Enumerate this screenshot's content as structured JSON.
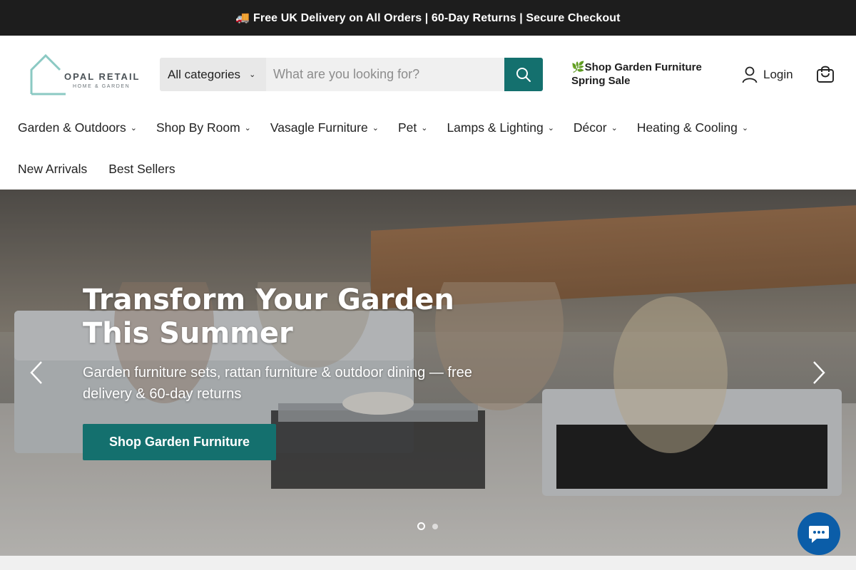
{
  "announcement": {
    "text": "🚚 Free UK Delivery on All Orders | 60-Day Returns | Secure Checkout"
  },
  "logo": {
    "name": "OPAL RETAIL",
    "tagline": "HOME & GARDEN"
  },
  "search": {
    "category_label": "All categories",
    "placeholder": "What are you looking for?",
    "button_icon": "search-icon"
  },
  "promo": {
    "text": "🌿Shop Garden Furniture Spring Sale"
  },
  "account": {
    "login_label": "Login",
    "cart_icon": "cart-icon"
  },
  "nav": {
    "primary": [
      {
        "label": "Garden & Outdoors"
      },
      {
        "label": "Shop By Room"
      },
      {
        "label": "Vasagle Furniture"
      },
      {
        "label": "Pet"
      },
      {
        "label": "Lamps & Lighting"
      },
      {
        "label": "Décor"
      },
      {
        "label": "Heating & Cooling"
      }
    ],
    "secondary": [
      {
        "label": "New Arrivals"
      },
      {
        "label": "Best Sellers"
      }
    ]
  },
  "hero": {
    "title": "Transform Your Garden This Summer",
    "subtitle": "Garden furniture sets, rattan furniture & outdoor dining — free delivery & 60-day returns",
    "cta_label": "Shop Garden Furniture",
    "slides": {
      "count": 2,
      "active": 1
    }
  },
  "colors": {
    "accent": "#14706e",
    "topbar": "#1d1d1d",
    "chat": "#0b5da8"
  }
}
